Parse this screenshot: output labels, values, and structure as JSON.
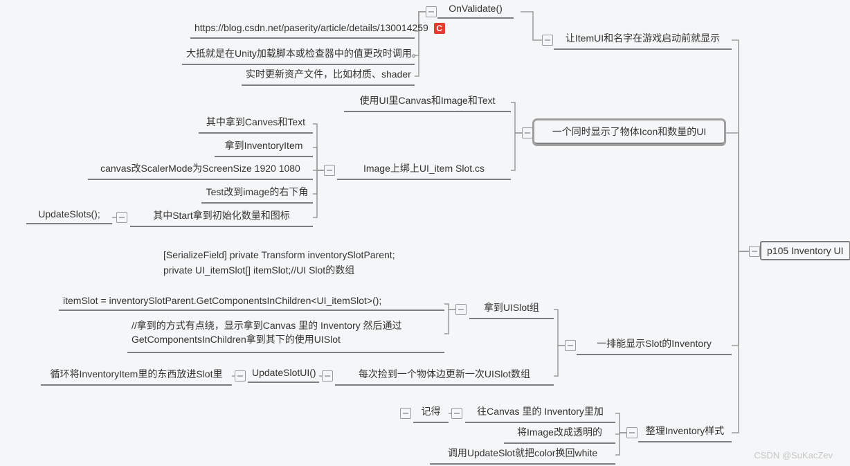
{
  "root": {
    "label": "p105 Inventory UI"
  },
  "a": {
    "title": "让ItemUI和名字在游戏启动前就显示",
    "sub": {
      "label": "OnValidate()",
      "children": [
        {
          "label": "https://blog.csdn.net/paserity/article/details/130014259",
          "icon": "C"
        },
        {
          "label": "大抵就是在Unity加载脚本或检查器中的值更改时调用。"
        },
        {
          "label": "实时更新资产文件，比如材质、shader"
        }
      ]
    }
  },
  "b": {
    "title": "一个同时显示了物体Icon和数量的UI",
    "c1": {
      "label": "使用UI里Canvas和Image和Text"
    },
    "c2": {
      "label": "Image上绑上UI_item Slot.cs",
      "children": [
        {
          "label": "其中拿到Canves和Text"
        },
        {
          "label": "拿到InventoryItem"
        },
        {
          "label": "canvas改ScalerMode为ScreenSize 1920 1080"
        },
        {
          "label": "Test改到image的右下角"
        },
        {
          "label": "其中Start拿到初始化数量和图标",
          "sub": "UpdateSlots();"
        }
      ]
    }
  },
  "c": {
    "title": "一排能显示Slot的Inventory",
    "pre": [
      "[SerializeField] private Transform inventorySlotParent;",
      "private UI_itemSlot[] itemSlot;//UI Slot的数组"
    ],
    "c1": {
      "label": "拿到UISlot组",
      "children": [
        {
          "label": "itemSlot = inventorySlotParent.GetComponentsInChildren<UI_itemSlot>();"
        },
        {
          "label": "//拿到的方式有点绕，显示拿到Canvas 里的 Inventory 然后通过GetComponentsInChildren拿到其下的使用UISlot"
        }
      ]
    },
    "c2": {
      "label": "每次捡到一个物体边更新一次UISlot数组",
      "sub": {
        "label": "UpdateSlotUI()",
        "sub": "循环将InventoryItem里的东西放进Slot里"
      }
    }
  },
  "d": {
    "title": "整理Inventory样式",
    "children": [
      {
        "label": "往Canvas 里的 Inventory里加",
        "sub": "记得"
      },
      {
        "label": "将Image改成透明的"
      },
      {
        "label": "调用UpdateSlot就把color换回white"
      }
    ]
  },
  "watermark": "CSDN @SuKacZev"
}
